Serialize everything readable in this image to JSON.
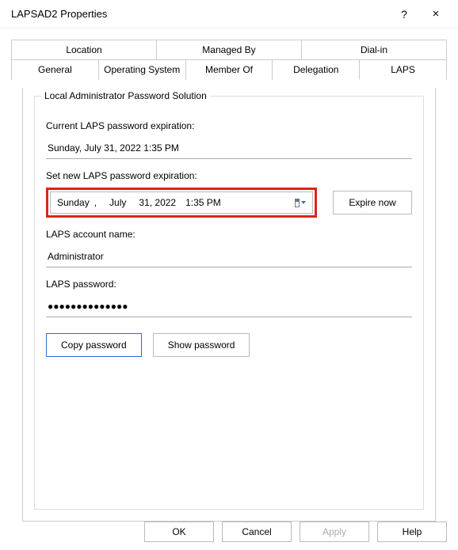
{
  "window": {
    "title": "LAPSAD2 Properties",
    "help_symbol": "?",
    "close_symbol": "×"
  },
  "tabs": {
    "row1": [
      "Location",
      "Managed By",
      "Dial-in"
    ],
    "row2": [
      "General",
      "Operating System",
      "Member Of",
      "Delegation",
      "LAPS"
    ],
    "active": "LAPS"
  },
  "group": {
    "legend": "Local Administrator Password Solution",
    "current_label": "Current LAPS password expiration:",
    "current_value": "Sunday, July 31, 2022 1:35 PM",
    "set_new_label": "Set new LAPS password expiration:",
    "date_picker": {
      "weekday": "Sunday",
      "comma": ",",
      "month": "July",
      "day_year": "31, 2022",
      "time": "1:35 PM"
    },
    "expire_now": "Expire now",
    "account_label": "LAPS account name:",
    "account_value": "Administrator",
    "password_label": "LAPS password:",
    "password_masked": "●●●●●●●●●●●●●●",
    "copy_btn": "Copy password",
    "show_btn": "Show password"
  },
  "buttons": {
    "ok": "OK",
    "cancel": "Cancel",
    "apply": "Apply",
    "help": "Help"
  }
}
